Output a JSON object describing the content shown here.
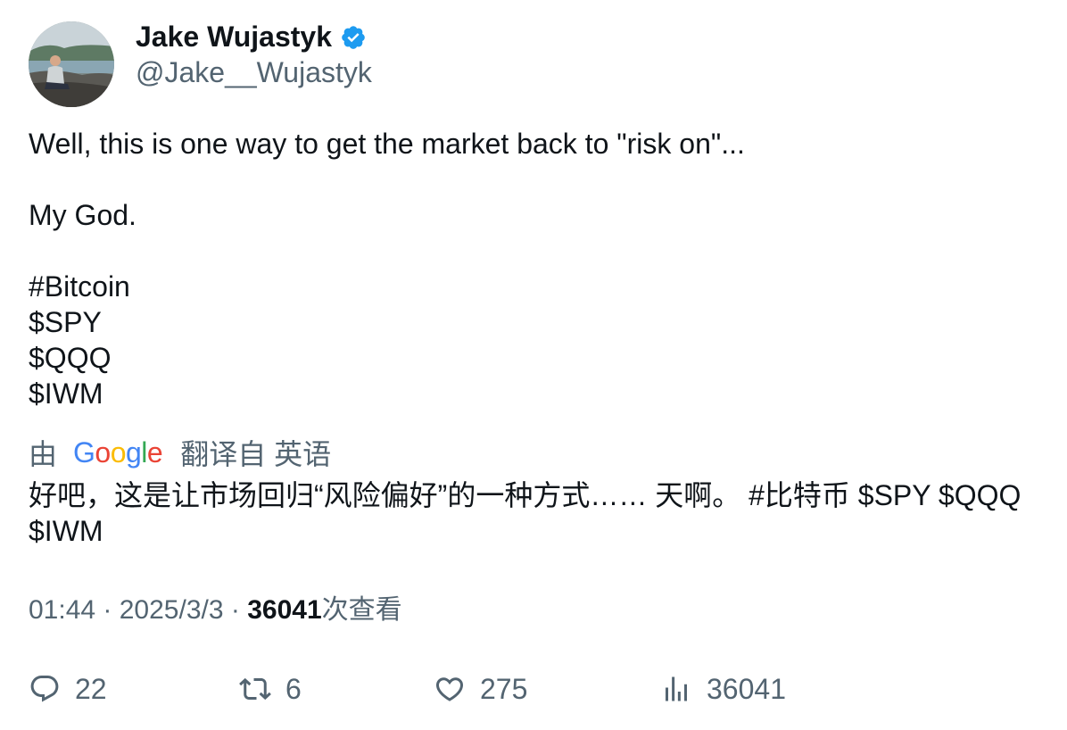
{
  "author": {
    "display_name": "Jake Wujastyk",
    "handle": "@Jake__Wujastyk",
    "verified_icon": "verified-badge-icon",
    "verified_color": "#1d9bf0"
  },
  "tweet": {
    "lines": [
      "Well, this is one way to get the market back to \"risk on\"...",
      "My God.",
      "#Bitcoin",
      "$SPY",
      "$QQQ",
      "$IWM"
    ]
  },
  "translation": {
    "by_label": "由",
    "google_letters": [
      "G",
      "o",
      "o",
      "g",
      "l",
      "e"
    ],
    "google_colors": [
      "#4285F4",
      "#EA4335",
      "#FBBC05",
      "#4285F4",
      "#34A853",
      "#EA4335"
    ],
    "from_label": "翻译自 英语",
    "text": "好吧，这是让市场回归“风险偏好”的一种方式…… 天啊。 #比特币 $SPY $QQQ $IWM"
  },
  "meta": {
    "time": "01:44",
    "separator": " · ",
    "date": "2025/3/3",
    "views_count": "36041",
    "views_label": "次查看"
  },
  "actions": [
    {
      "icon": "reply-icon",
      "count": "22"
    },
    {
      "icon": "retweet-icon",
      "count": "6"
    },
    {
      "icon": "like-icon",
      "count": "275"
    },
    {
      "icon": "views-icon",
      "count": "36041"
    }
  ],
  "colors": {
    "text_primary": "#0f1419",
    "text_secondary": "#536471"
  }
}
